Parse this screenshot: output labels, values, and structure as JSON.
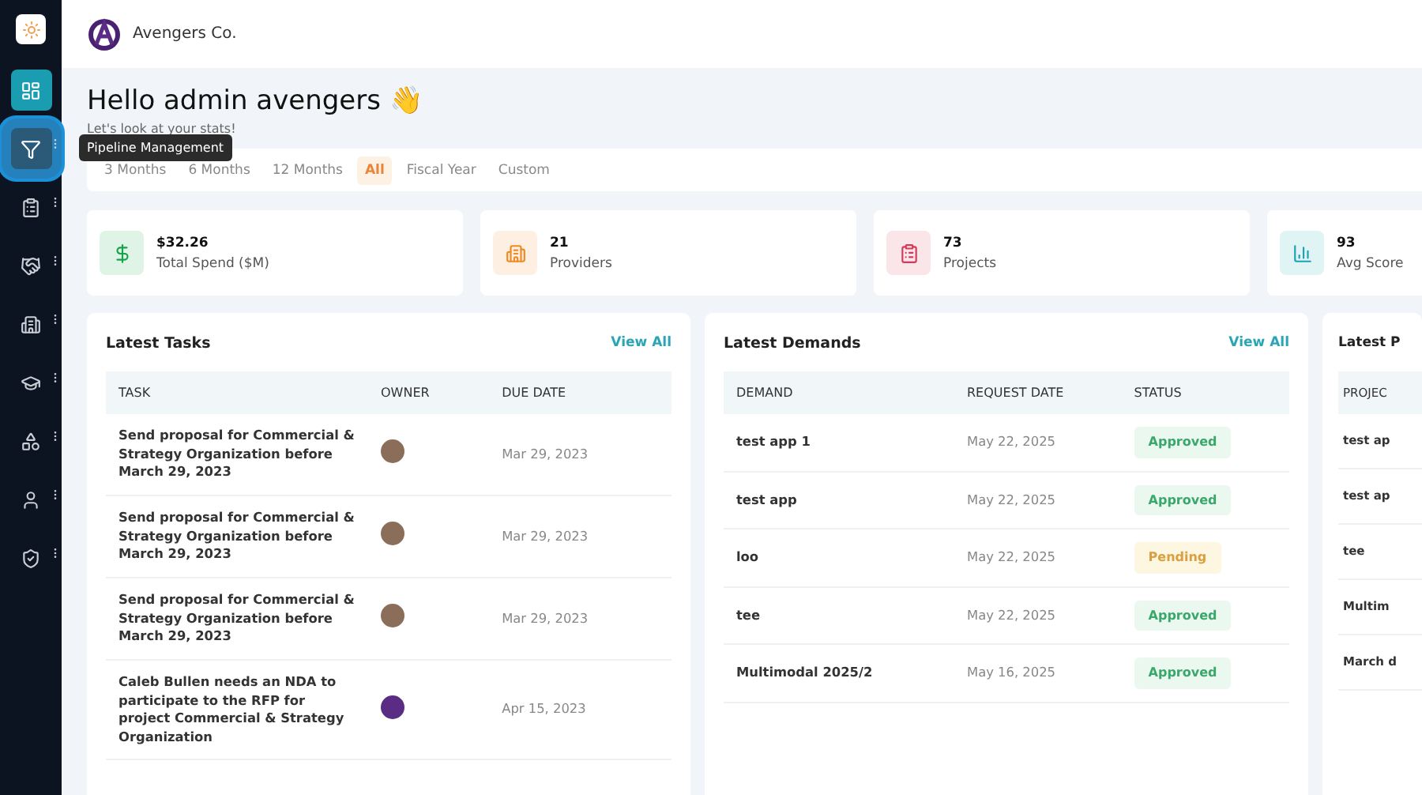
{
  "brand": {
    "name": "Avengers Co."
  },
  "sidebar": {
    "items": [
      {
        "kind": "dashboard",
        "selected": true,
        "highlighted": false,
        "menu": false
      },
      {
        "kind": "filter",
        "selected": false,
        "highlighted": true,
        "menu": true
      },
      {
        "kind": "clipboard",
        "selected": false,
        "highlighted": false,
        "menu": true
      },
      {
        "kind": "handshake",
        "selected": false,
        "highlighted": false,
        "menu": true
      },
      {
        "kind": "building",
        "selected": false,
        "highlighted": false,
        "menu": true
      },
      {
        "kind": "cap",
        "selected": false,
        "highlighted": false,
        "menu": true
      },
      {
        "kind": "shapes",
        "selected": false,
        "highlighted": false,
        "menu": true
      },
      {
        "kind": "user",
        "selected": false,
        "highlighted": false,
        "menu": true
      },
      {
        "kind": "shield",
        "selected": false,
        "highlighted": false,
        "menu": true
      }
    ],
    "tooltip": "Pipeline Management"
  },
  "greeting": {
    "title": "Hello admin avengers",
    "emoji": "👋",
    "subtitle": "Let's look at your stats!"
  },
  "periods": [
    {
      "label": "3 Months",
      "selected": false
    },
    {
      "label": "6 Months",
      "selected": false
    },
    {
      "label": "12 Months",
      "selected": false
    },
    {
      "label": "All",
      "selected": true
    },
    {
      "label": "Fiscal Year",
      "selected": false
    },
    {
      "label": "Custom",
      "selected": false
    }
  ],
  "stats": [
    {
      "kind": "dollar",
      "value": "$32.26",
      "label": "Total Spend ($M)",
      "color": "#16a34a"
    },
    {
      "kind": "building",
      "value": "21",
      "label": "Providers",
      "color": "#f08a24"
    },
    {
      "kind": "clipboard",
      "value": "73",
      "label": "Projects",
      "color": "#d63a5a"
    },
    {
      "kind": "chart",
      "value": "93",
      "label": "Avg Score",
      "color": "#1aa3b5"
    }
  ],
  "tasks": {
    "title": "Latest Tasks",
    "link": "View All",
    "columns": [
      "TASK",
      "OWNER",
      "DUE DATE"
    ],
    "rows": [
      {
        "task": "Send proposal for Commercial & Strategy Organization before March 29, 2023",
        "owner_logo": false,
        "due": "Mar 29, 2023"
      },
      {
        "task": "Send proposal for Commercial & Strategy Organization before March 29, 2023",
        "owner_logo": false,
        "due": "Mar 29, 2023"
      },
      {
        "task": "Send proposal for Commercial & Strategy Organization before March 29, 2023",
        "owner_logo": false,
        "due": "Mar 29, 2023"
      },
      {
        "task": "Caleb Bullen needs an NDA to participate to the RFP for project Commercial & Strategy Organization",
        "owner_logo": true,
        "due": "Apr 15, 2023"
      }
    ]
  },
  "demands": {
    "title": "Latest Demands",
    "link": "View All",
    "columns": [
      "DEMAND",
      "REQUEST DATE",
      "STATUS"
    ],
    "rows": [
      {
        "demand": "test app 1",
        "date": "May 22, 2025",
        "status": "Approved",
        "kind": "approved"
      },
      {
        "demand": "test app",
        "date": "May 22, 2025",
        "status": "Approved",
        "kind": "approved"
      },
      {
        "demand": "loo",
        "date": "May 22, 2025",
        "status": "Pending",
        "kind": "pending"
      },
      {
        "demand": "tee",
        "date": "May 22, 2025",
        "status": "Approved",
        "kind": "approved"
      },
      {
        "demand": "Multimodal 2025/2",
        "date": "May 16, 2025",
        "status": "Approved",
        "kind": "approved"
      }
    ]
  },
  "projects": {
    "title": "Latest P",
    "column_1": "PROJEC",
    "rows": [
      "test ap",
      "test ap",
      "tee",
      "Multim",
      "March d"
    ]
  }
}
